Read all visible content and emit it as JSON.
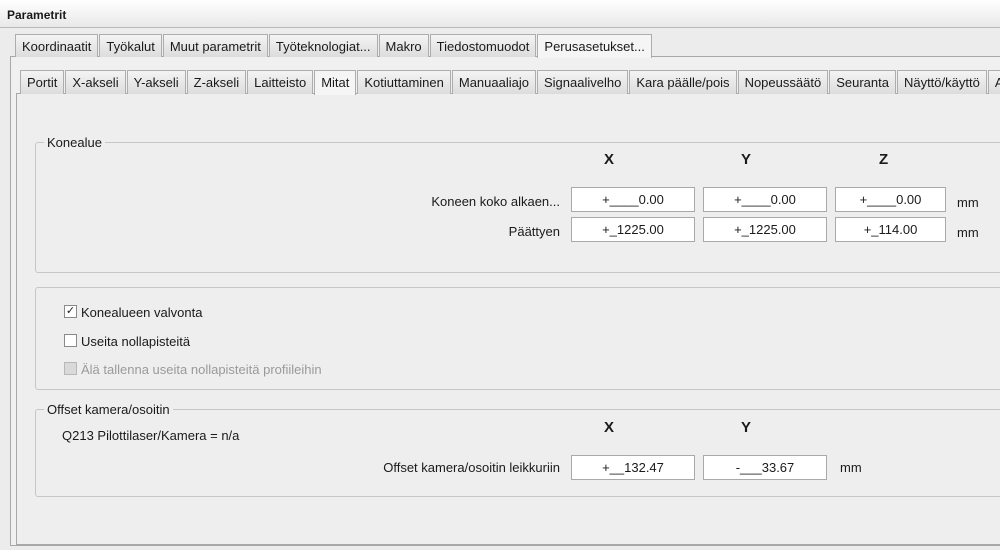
{
  "window": {
    "title": "Parametrit"
  },
  "top_tabs": [
    {
      "label": "Koordinaatit"
    },
    {
      "label": "Työkalut"
    },
    {
      "label": "Muut parametrit"
    },
    {
      "label": "Työteknologiat..."
    },
    {
      "label": "Makro"
    },
    {
      "label": "Tiedostomuodot"
    },
    {
      "label": "Perusasetukset..."
    }
  ],
  "sub_tabs": [
    {
      "label": "Portit"
    },
    {
      "label": "X-akseli"
    },
    {
      "label": "Y-akseli"
    },
    {
      "label": "Z-akseli"
    },
    {
      "label": "Laitteisto"
    },
    {
      "label": "Mitat"
    },
    {
      "label": "Kotiuttaminen"
    },
    {
      "label": "Manuaaliajo"
    },
    {
      "label": "Signaalivelho"
    },
    {
      "label": "Kara päälle/pois"
    },
    {
      "label": "Nopeussäätö"
    },
    {
      "label": "Seuranta"
    },
    {
      "label": "Näyttö/käyttö"
    },
    {
      "label": "Anturi"
    }
  ],
  "machine_area": {
    "title": "Konealue",
    "col_x": "X",
    "col_y": "Y",
    "col_z": "Z",
    "row_start": {
      "label": "Koneen koko alkaen...",
      "x": "+____0.00",
      "y": "+____0.00",
      "z": "+____0.00",
      "unit": "mm"
    },
    "row_end": {
      "label": "Päättyen",
      "x": "+_1225.00",
      "y": "+_1225.00",
      "z": "+_114.00",
      "unit": "mm"
    }
  },
  "options": {
    "machine_area_monitoring": {
      "label": "Konealueen valvonta",
      "checked": "✓"
    },
    "multiple_zero_points": {
      "label": "Useita nollapisteitä",
      "checked": ""
    },
    "dont_save_zero_points": {
      "label": "Älä tallenna useita nollapisteitä profiileihin",
      "checked": ""
    }
  },
  "offset": {
    "title": "Offset kamera/osoitin",
    "info": "Q213 Pilottilaser/Kamera = n/a",
    "col_x": "X",
    "col_y": "Y",
    "label": "Offset kamera/osoitin leikkuriin",
    "x": "+__132.47",
    "y": "-___33.67",
    "unit": "mm"
  }
}
